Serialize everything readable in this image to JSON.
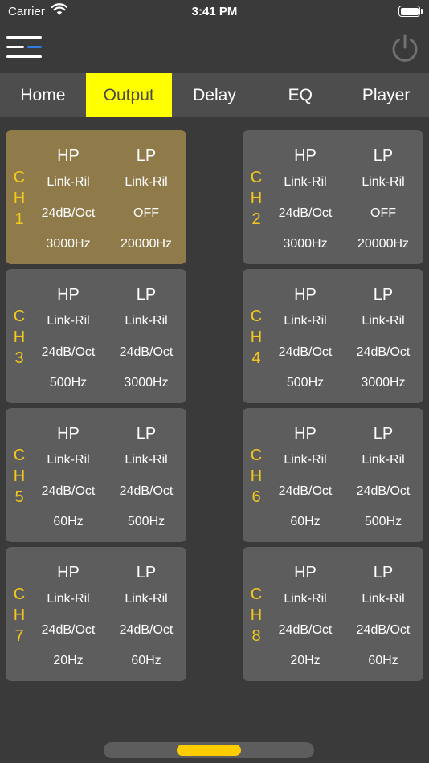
{
  "status_bar": {
    "carrier": "Carrier",
    "time": "3:41 PM",
    "wifi_icon": "wifi-icon",
    "battery_icon": "battery-icon"
  },
  "header": {
    "menu_icon": "menu-icon",
    "power_icon": "power-icon"
  },
  "tabs": [
    {
      "label": "Home",
      "active": false
    },
    {
      "label": "Output",
      "active": true
    },
    {
      "label": "Delay",
      "active": false
    },
    {
      "label": "EQ",
      "active": false
    },
    {
      "label": "Player",
      "active": false
    }
  ],
  "channels": [
    {
      "ch": [
        "C",
        "H",
        "1"
      ],
      "selected": true,
      "hp": {
        "label": "HP",
        "type": "Link-Ril",
        "slope": "24dB/Oct",
        "freq": "3000Hz"
      },
      "lp": {
        "label": "LP",
        "type": "Link-Ril",
        "slope": "OFF",
        "freq": "20000Hz"
      }
    },
    {
      "ch": [
        "C",
        "H",
        "2"
      ],
      "selected": false,
      "hp": {
        "label": "HP",
        "type": "Link-Ril",
        "slope": "24dB/Oct",
        "freq": "3000Hz"
      },
      "lp": {
        "label": "LP",
        "type": "Link-Ril",
        "slope": "OFF",
        "freq": "20000Hz"
      }
    },
    {
      "ch": [
        "C",
        "H",
        "3"
      ],
      "selected": false,
      "hp": {
        "label": "HP",
        "type": "Link-Ril",
        "slope": "24dB/Oct",
        "freq": "500Hz"
      },
      "lp": {
        "label": "LP",
        "type": "Link-Ril",
        "slope": "24dB/Oct",
        "freq": "3000Hz"
      }
    },
    {
      "ch": [
        "C",
        "H",
        "4"
      ],
      "selected": false,
      "hp": {
        "label": "HP",
        "type": "Link-Ril",
        "slope": "24dB/Oct",
        "freq": "500Hz"
      },
      "lp": {
        "label": "LP",
        "type": "Link-Ril",
        "slope": "24dB/Oct",
        "freq": "3000Hz"
      }
    },
    {
      "ch": [
        "C",
        "H",
        "5"
      ],
      "selected": false,
      "hp": {
        "label": "HP",
        "type": "Link-Ril",
        "slope": "24dB/Oct",
        "freq": "60Hz"
      },
      "lp": {
        "label": "LP",
        "type": "Link-Ril",
        "slope": "24dB/Oct",
        "freq": "500Hz"
      }
    },
    {
      "ch": [
        "C",
        "H",
        "6"
      ],
      "selected": false,
      "hp": {
        "label": "HP",
        "type": "Link-Ril",
        "slope": "24dB/Oct",
        "freq": "60Hz"
      },
      "lp": {
        "label": "LP",
        "type": "Link-Ril",
        "slope": "24dB/Oct",
        "freq": "500Hz"
      }
    },
    {
      "ch": [
        "C",
        "H",
        "7"
      ],
      "selected": false,
      "hp": {
        "label": "HP",
        "type": "Link-Ril",
        "slope": "24dB/Oct",
        "freq": "20Hz"
      },
      "lp": {
        "label": "LP",
        "type": "Link-Ril",
        "slope": "24dB/Oct",
        "freq": "60Hz"
      }
    },
    {
      "ch": [
        "C",
        "H",
        "8"
      ],
      "selected": false,
      "hp": {
        "label": "HP",
        "type": "Link-Ril",
        "slope": "24dB/Oct",
        "freq": "20Hz"
      },
      "lp": {
        "label": "LP",
        "type": "Link-Ril",
        "slope": "24dB/Oct",
        "freq": "60Hz"
      }
    }
  ],
  "colors": {
    "background": "#3a3a3a",
    "tabbar": "#4d4d4d",
    "active_tab": "#ffff00",
    "card": "#5d5d5d",
    "card_selected": "#8f7a4a",
    "channel_label": "#f5c91c",
    "menu_accent": "#2f7de1",
    "scroll_thumb": "#ffcc00"
  }
}
